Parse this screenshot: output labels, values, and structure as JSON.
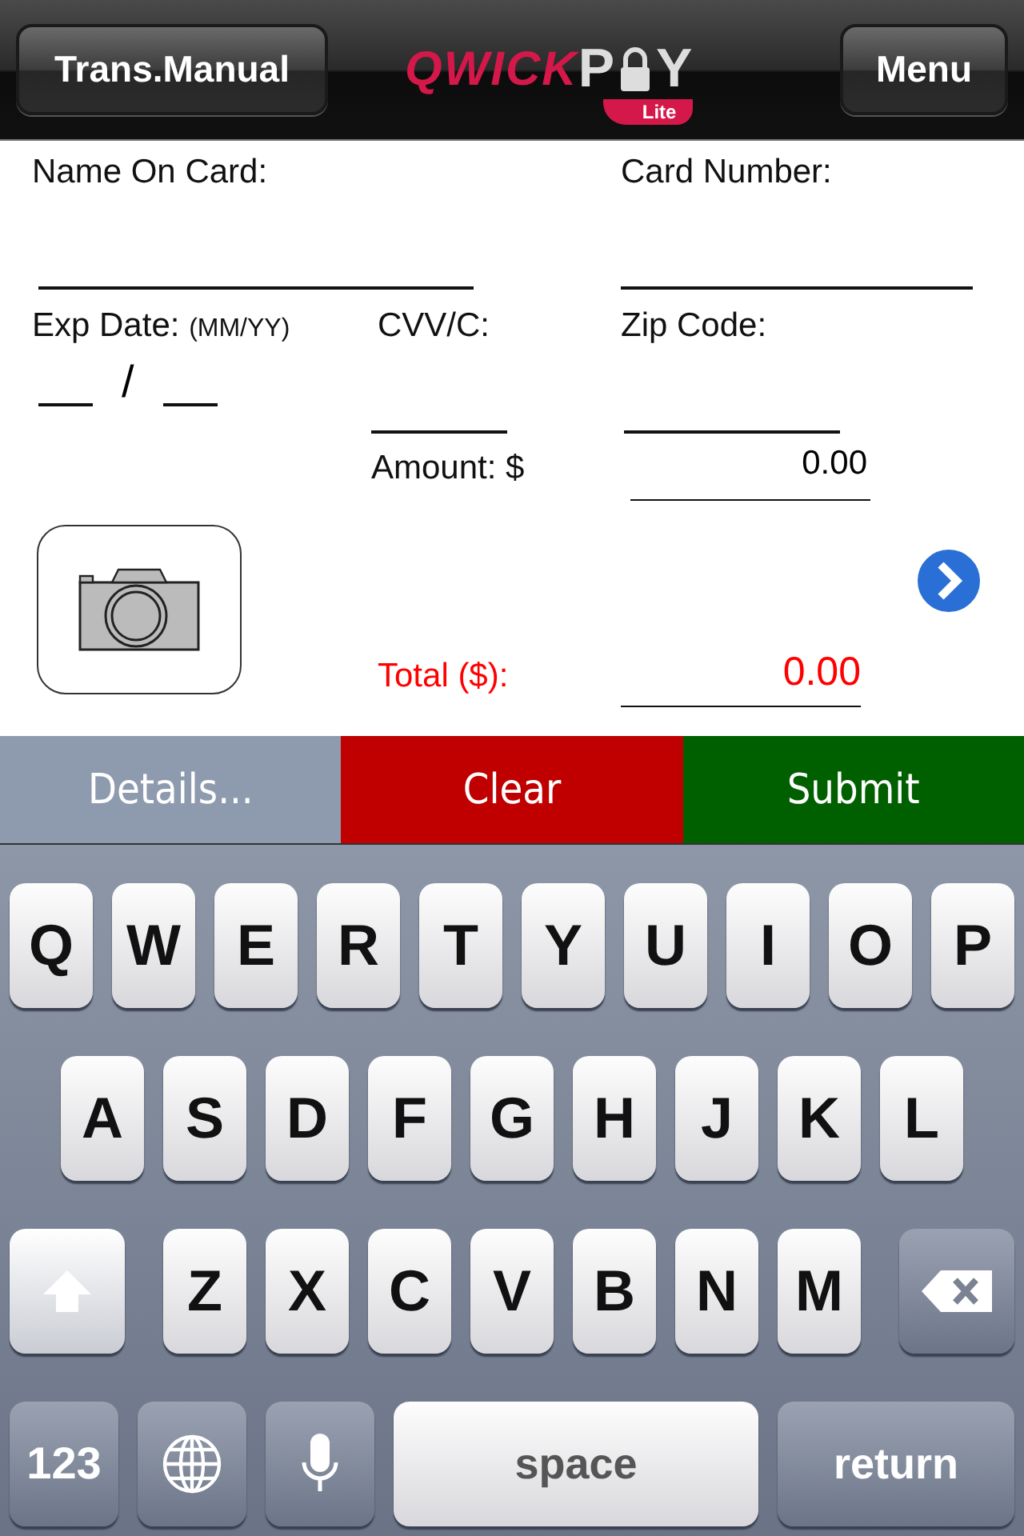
{
  "header": {
    "left_button": "Trans.Manual",
    "logo": {
      "brand_first": "QWICK",
      "brand_p": "P",
      "brand_y": "Y",
      "edition": "Lite"
    },
    "right_button": "Menu"
  },
  "form": {
    "name_label": "Name On Card:",
    "card_number_label": "Card Number:",
    "exp_label": "Exp Date:",
    "exp_hint": "(MM/YY)",
    "exp_separator": "/",
    "cvv_label": "CVV/C:",
    "zip_label": "Zip Code:",
    "amount_label": "Amount: $",
    "amount_value": "0.00",
    "total_label": "Total ($):",
    "total_value": "0.00"
  },
  "actions": [
    {
      "label": "Details...",
      "color": "#8e9bae"
    },
    {
      "label": "Clear",
      "color": "#c00000"
    },
    {
      "label": "Submit",
      "color": "#006000"
    }
  ],
  "keyboard": {
    "rows": [
      {
        "keys": [
          {
            "kind": "letter",
            "label": "Q"
          },
          {
            "kind": "letter",
            "label": "W"
          },
          {
            "kind": "letter",
            "label": "E"
          },
          {
            "kind": "letter",
            "label": "R"
          },
          {
            "kind": "letter",
            "label": "T"
          },
          {
            "kind": "letter",
            "label": "Y"
          },
          {
            "kind": "letter",
            "label": "U"
          },
          {
            "kind": "letter",
            "label": "I"
          },
          {
            "kind": "letter",
            "label": "O"
          },
          {
            "kind": "letter",
            "label": "P"
          }
        ]
      },
      {
        "keys": [
          {
            "kind": "letter",
            "label": "A"
          },
          {
            "kind": "letter",
            "label": "S"
          },
          {
            "kind": "letter",
            "label": "D"
          },
          {
            "kind": "letter",
            "label": "F"
          },
          {
            "kind": "letter",
            "label": "G"
          },
          {
            "kind": "letter",
            "label": "H"
          },
          {
            "kind": "letter",
            "label": "J"
          },
          {
            "kind": "letter",
            "label": "K"
          },
          {
            "kind": "letter",
            "label": "L"
          }
        ]
      },
      {
        "keys": [
          {
            "kind": "shift"
          },
          {
            "kind": "letter",
            "label": "Z"
          },
          {
            "kind": "letter",
            "label": "X"
          },
          {
            "kind": "letter",
            "label": "C"
          },
          {
            "kind": "letter",
            "label": "V"
          },
          {
            "kind": "letter",
            "label": "B"
          },
          {
            "kind": "letter",
            "label": "N"
          },
          {
            "kind": "letter",
            "label": "M"
          },
          {
            "kind": "backspace"
          }
        ]
      },
      {
        "keys": [
          {
            "kind": "mode",
            "label": "123"
          },
          {
            "kind": "globe"
          },
          {
            "kind": "mic"
          },
          {
            "kind": "space",
            "label": "space"
          },
          {
            "kind": "return",
            "label": "return"
          }
        ]
      }
    ]
  }
}
